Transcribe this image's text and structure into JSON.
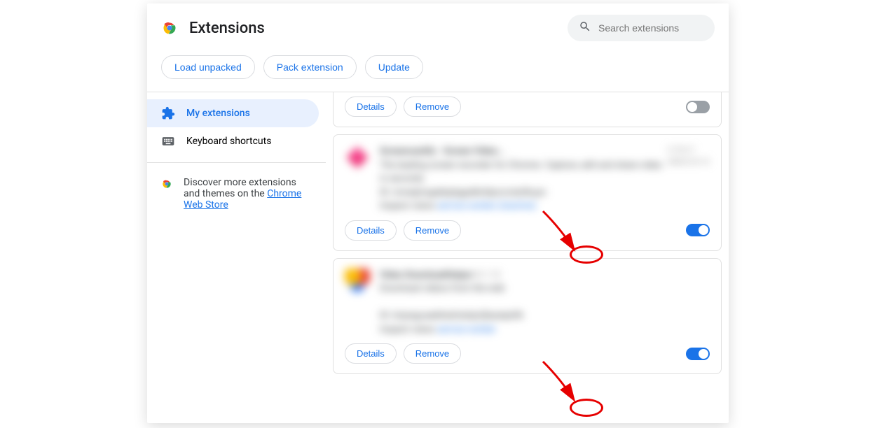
{
  "header": {
    "title": "Extensions",
    "search_placeholder": "Search extensions"
  },
  "toolbar": {
    "load_unpacked": "Load unpacked",
    "pack_extension": "Pack extension",
    "update": "Update"
  },
  "sidebar": {
    "my_extensions": "My extensions",
    "keyboard_shortcuts": "Keyboard shortcuts",
    "discover_prefix": "Discover more extensions and themes on the ",
    "discover_link": "Chrome Web Store"
  },
  "cards": {
    "details": "Details",
    "remove": "Remove",
    "ext1": {
      "title": "Screencastify - Screen Video...",
      "version": "2.70.0.7",
      "subversion": "v8023-23-12",
      "desc1": "The leading screen recorder for Chrome. Capture, edit and share video in seconds.",
      "desc2": "ID: mmeijimgabbpbgpdklnllpncmdofkcpn",
      "desc3_prefix": "Inspect views ",
      "desc3_link": "service worker (inactive)",
      "enabled": true
    },
    "ext2": {
      "title": "Video DownloadHelper",
      "version": "8.1.12",
      "desc1": "Download videos from the web",
      "desc2": "ID: lmjnegcaeklhafolokijcfjliaokphfk",
      "desc3_prefix": "Inspect views ",
      "desc3_link": "service worker",
      "enabled": true
    },
    "ext0": {
      "enabled": false
    }
  }
}
